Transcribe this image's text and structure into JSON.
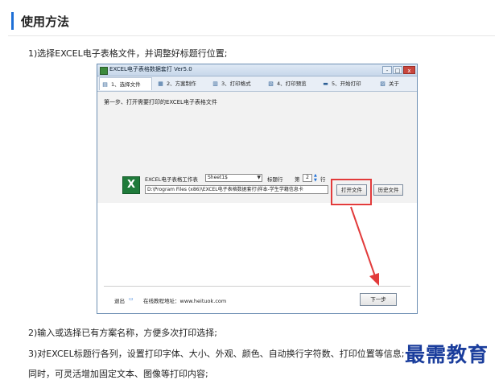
{
  "section": {
    "title": "使用方法"
  },
  "paragraphs": {
    "p1": "1)选择EXCEL电子表格文件，并调整好标题行位置;",
    "p2": "2)输入或选择已有方案名称，方便多次打印选择;",
    "p3": "3)对EXCEL标题行各列，设置打印字体、大小、外观、颜色、自动换行字符数、打印位置等信息;",
    "p4": "同时，可灵活增加固定文本、图像等打印内容;"
  },
  "app": {
    "title": "EXCEL电子表格数据套打 Ver5.0",
    "window_buttons": {
      "minimize": "-",
      "maximize": "□",
      "close": "x"
    },
    "tabs": [
      {
        "label": "1、选择文件",
        "icon": "file-icon"
      },
      {
        "label": "2、方案制作",
        "icon": "design-icon"
      },
      {
        "label": "3、打印格式",
        "icon": "format-icon"
      },
      {
        "label": "4、打印预览",
        "icon": "preview-icon"
      },
      {
        "label": "5、开始打印",
        "icon": "printer-icon"
      },
      {
        "label": "关于",
        "icon": "about-icon"
      }
    ],
    "step_label": "第一步、打开需要打印的EXCEL电子表格文件",
    "worksheet_label": "EXCEL电子表格工作表",
    "sheet_value": "Sheet1$",
    "title_row_label": "标题行",
    "row_prefix": "第",
    "row_value": "2",
    "row_suffix": "行",
    "file_path": "D:\\Program Files (x86)\\EXCEL电子表格数据套打\\样本-学生学籍信息卡",
    "open_button": "打开文件",
    "history_button": "历史文件",
    "exit_label": "退出",
    "website_label": "在线教程地址：www.heituok.com",
    "next_button": "下一步",
    "excel_icon_glyph": "X"
  },
  "watermark": "最需教育",
  "colors": {
    "accent": "#1e6fd6",
    "highlight": "#e23b3b",
    "watermark": "#1a3d9c"
  }
}
